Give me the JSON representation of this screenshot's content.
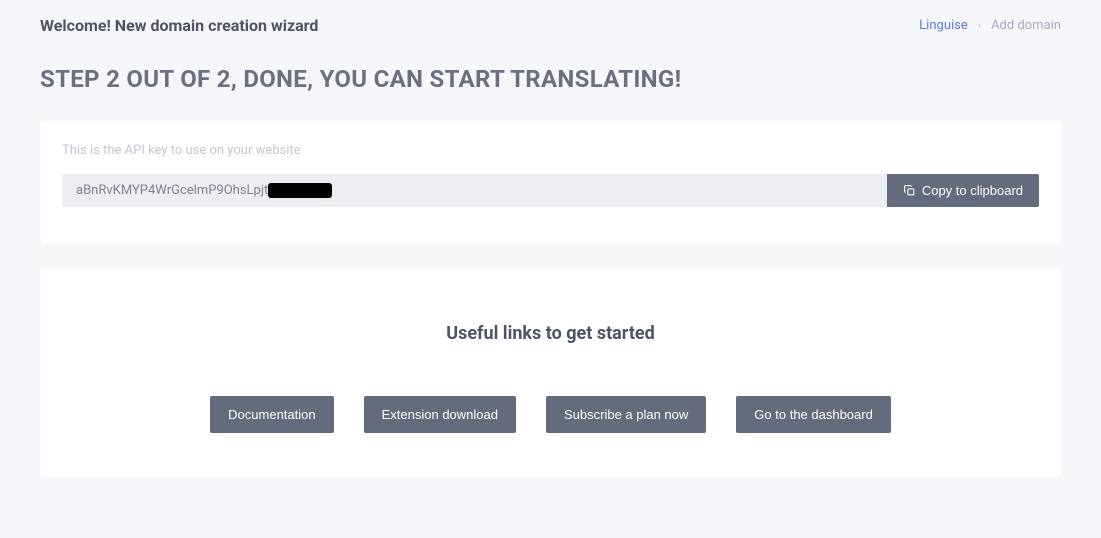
{
  "header": {
    "welcome_title": "Welcome! New domain creation wizard"
  },
  "breadcrumb": {
    "root": "Linguise",
    "current": "Add domain"
  },
  "step_heading": "STEP 2 OUT OF 2, DONE, YOU CAN START TRANSLATING!",
  "api_section": {
    "label": "This is the API key to use on your website",
    "key_visible": "aBnRvKMYP4WrGcelmP9OhsLpjt",
    "copy_label": "Copy to clipboard"
  },
  "links_section": {
    "heading": "Useful links to get started",
    "buttons": [
      "Documentation",
      "Extension download",
      "Subscribe a plan now",
      "Go to the dashboard"
    ]
  }
}
